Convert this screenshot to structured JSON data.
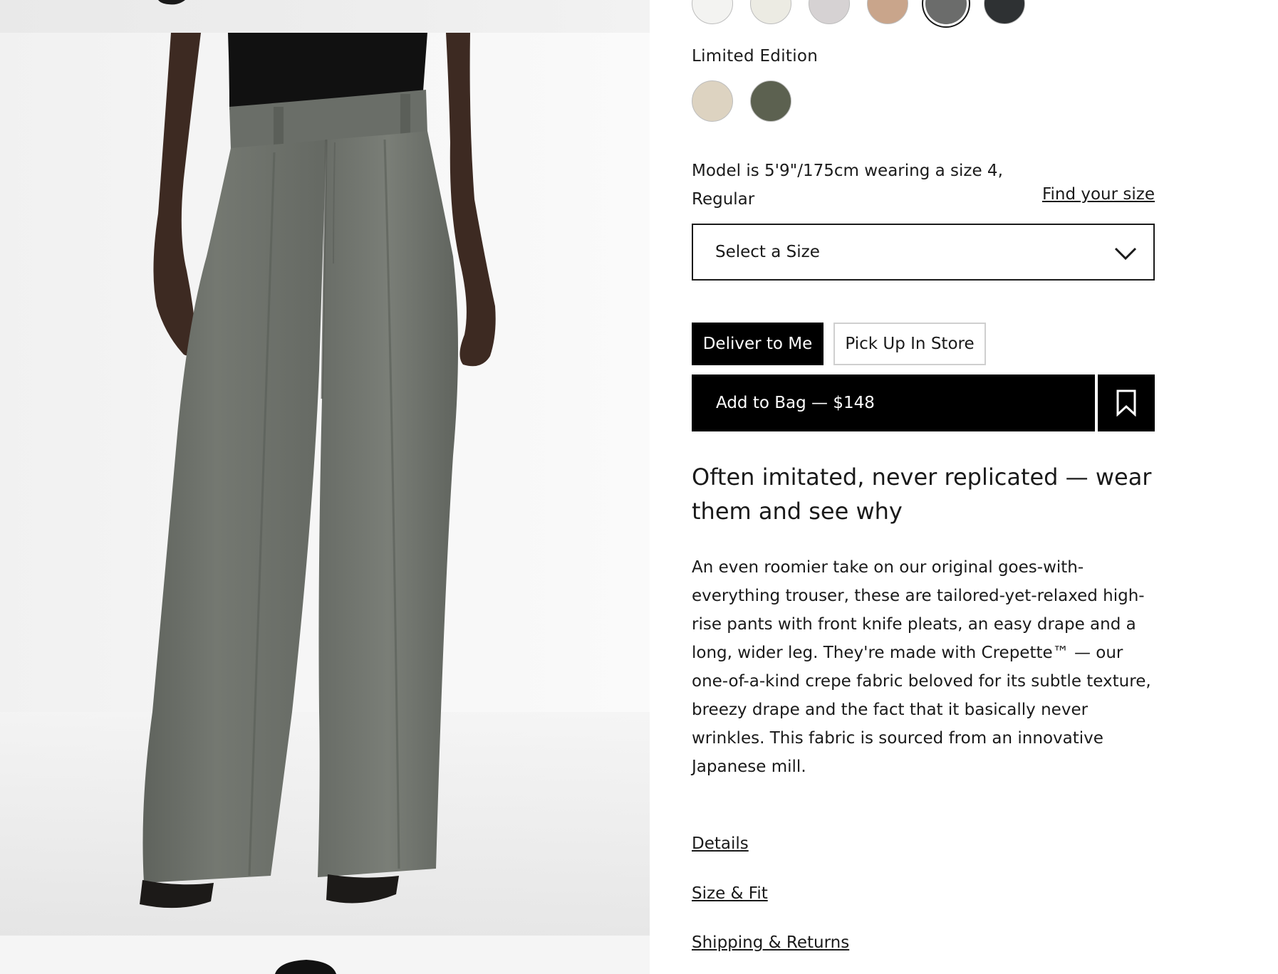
{
  "colors": {
    "top_swatches": [
      {
        "name": "white",
        "hex": "#f3f3f1"
      },
      {
        "name": "ivory",
        "hex": "#ecebe3"
      },
      {
        "name": "light-grey",
        "hex": "#d6d2d3"
      },
      {
        "name": "camel",
        "hex": "#c9a58b"
      },
      {
        "name": "grey",
        "hex": "#6b6c6b",
        "selected": true
      },
      {
        "name": "charcoal",
        "hex": "#2e3133"
      }
    ],
    "limited_swatches": [
      {
        "name": "sand",
        "hex": "#ddd3c1"
      },
      {
        "name": "olive",
        "hex": "#5c6150"
      }
    ],
    "accent": "#000000",
    "pants": "#6f736d"
  },
  "limited_edition_label": "Limited Edition",
  "model_info": "Model is 5'9\"/175cm wearing a size 4, Regular",
  "find_size_label": "Find your size",
  "size_select": {
    "placeholder": "Select a Size",
    "icon": "chevron-down-icon"
  },
  "delivery": {
    "deliver_label": "Deliver to Me",
    "pickup_label": "Pick Up In Store",
    "active": "deliver"
  },
  "add_to_bag_label": "Add to Bag — $148",
  "wishlist_icon": "bookmark-icon",
  "headline": "Often imitated, never replicated — wear them and see why",
  "description": "An even roomier take on our original goes-with-everything trouser, these are tailored-yet-relaxed high-rise pants with front knife pleats, an easy drape and a long, wider leg. They're made with Crepette™ — our one-of-a-kind crepe fabric beloved for its subtle texture, breezy drape and the fact that it basically never wrinkles. This fabric is sourced from an innovative Japanese mill.",
  "links": {
    "details": "Details",
    "size_fit": "Size & Fit",
    "shipping_returns": "Shipping & Returns"
  }
}
